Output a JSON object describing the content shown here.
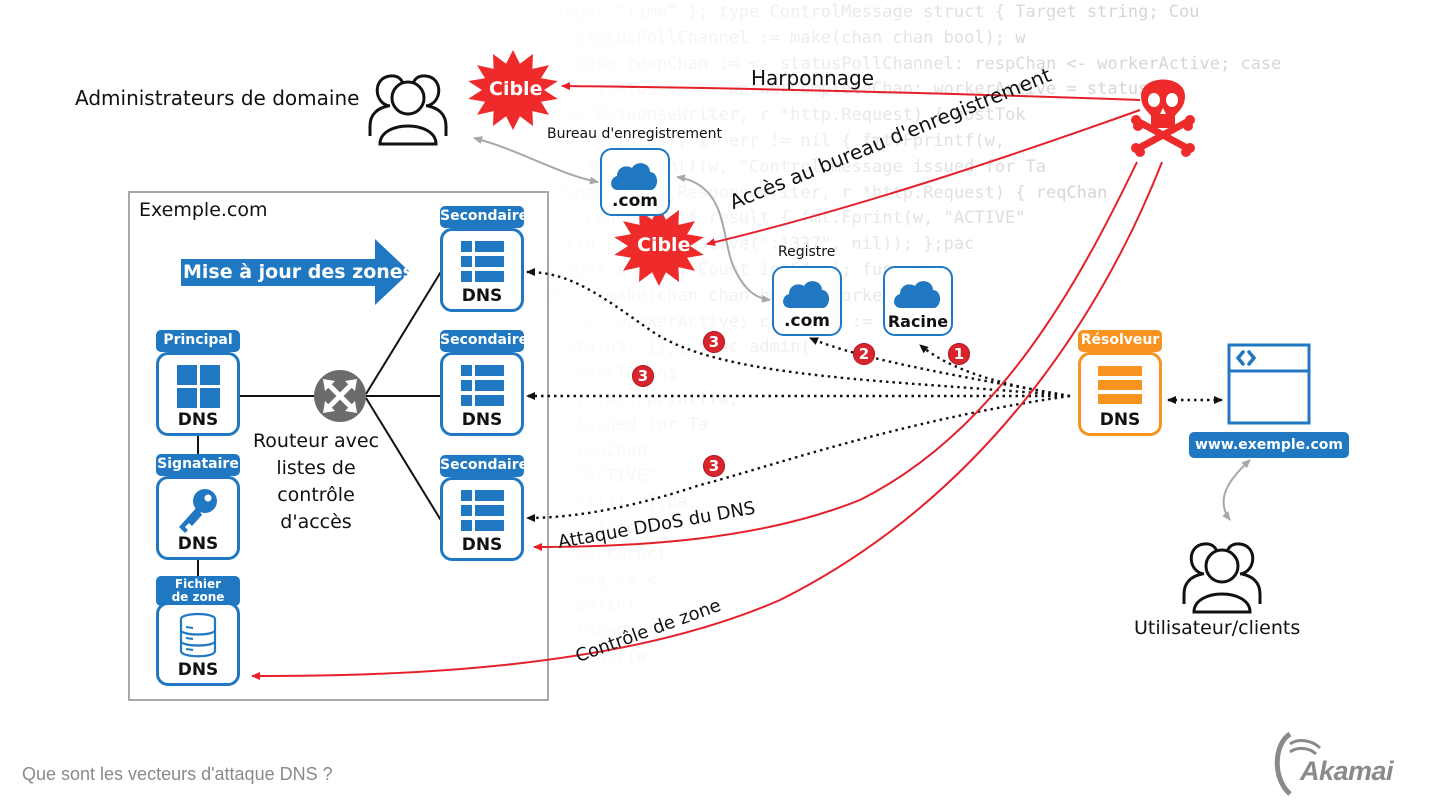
{
  "title": "Que sont les vecteurs d'attaque DNS ?",
  "brand": "Akamai",
  "colors": {
    "primary_blue": "#1f78c1",
    "attack_red": "#e4212b",
    "badge_red": "#d8242c",
    "resolver_orange": "#f7931e",
    "router_gray": "#6b6b6b",
    "footer_gray": "#8a8a8a"
  },
  "background_code": [
    "strings\" \"time\" ); type ControlMessage struct { Target string; Cou",
    "ol); statusPollChannel := make(chan chan bool); w",
    "     case respChan := <- statusPollChannel: respChan <- workerActive; case",
    "       status := <- workerCompleteChan: workerActive = status;",
    "  http.ResponseWriter, r *http.Request) { hostTok",
    "   Count int64); if err != nil { fmt.Fprintf(w,",
    "      fmt.Fprintf(w, \"Control message issued for Ta",
    "   func(w http.ResponseWriter, r *http.Request) { reqChan",
    "   <- reqChan; if result { fmt.Fprint(w, \"ACTIVE\"",
    "   http.ListenAndServe(\":1337\", nil)); };pac",
    "  Target string; Count int64; ); func ma",
    "  ol := make(chan chan bool); workerActi",
    "      <- workerActive; case msg := <-",
    "    status; }}}; func admin(",
    "     hostTokens",
    "     { fmt.Fprintf(w,",
    "     issued for Ta",
    "     reqChan",
    "     \"ACTIVE\"",
    "     nil)); };pa",
    "     ; func ma",
    "     workerAct",
    "     msg := <",
    "     admin(",
    "     Tokens",
    "     rintf(w"
  ],
  "actors": {
    "domain_admins": "Administrateurs de domaine",
    "users": "Utilisateur/clients",
    "attacker": "skull-crossbones"
  },
  "targets": [
    {
      "label": "Cible",
      "at": "domain_admins"
    },
    {
      "label": "Cible",
      "at": "registrar"
    }
  ],
  "attack_labels": {
    "spear_phishing": "Harponnage",
    "registrar_access": "Accès au bureau d'enregistrement",
    "ddos": "Attaque DDoS du DNS",
    "zone_control": "Contrôle de zone"
  },
  "registrar": {
    "title": "Bureau d'enregistrement",
    "label": ".com"
  },
  "registry": {
    "title": "Registre",
    "label": ".com"
  },
  "root": {
    "label": "Racine"
  },
  "example_zone": {
    "title": "Exemple.com",
    "zone_update": "Mise à jour des zones",
    "router_label": "Routeur avec listes de contrôle d'accès",
    "router_lines": [
      "Routeur avec",
      "listes de",
      "contrôle",
      "d'accès"
    ],
    "servers": [
      {
        "tag": "Principal",
        "label": "DNS",
        "icon": "grid-icon"
      },
      {
        "tag": "Signataire",
        "label": "DNS",
        "icon": "key-icon"
      },
      {
        "tag": "Fichier de zone",
        "tag_lines": [
          "Fichier",
          "de zone"
        ],
        "label": "DNS",
        "icon": "database-icon"
      },
      {
        "tag": "Secondaire",
        "label": "DNS",
        "icon": "list-icon"
      },
      {
        "tag": "Secondaire",
        "label": "DNS",
        "icon": "list-icon"
      },
      {
        "tag": "Secondaire",
        "label": "DNS",
        "icon": "list-icon"
      }
    ]
  },
  "resolver": {
    "tag": "Résolveur",
    "label": "DNS"
  },
  "website": {
    "label": "www.exemple.com"
  },
  "query_steps": [
    {
      "number": "1",
      "to": "Racine"
    },
    {
      "number": "2",
      "to": "Registre .com"
    },
    {
      "number": "3",
      "to": "Secondaire 1"
    },
    {
      "number": "3",
      "to": "Secondaire 2"
    },
    {
      "number": "3",
      "to": "Secondaire 3"
    }
  ]
}
